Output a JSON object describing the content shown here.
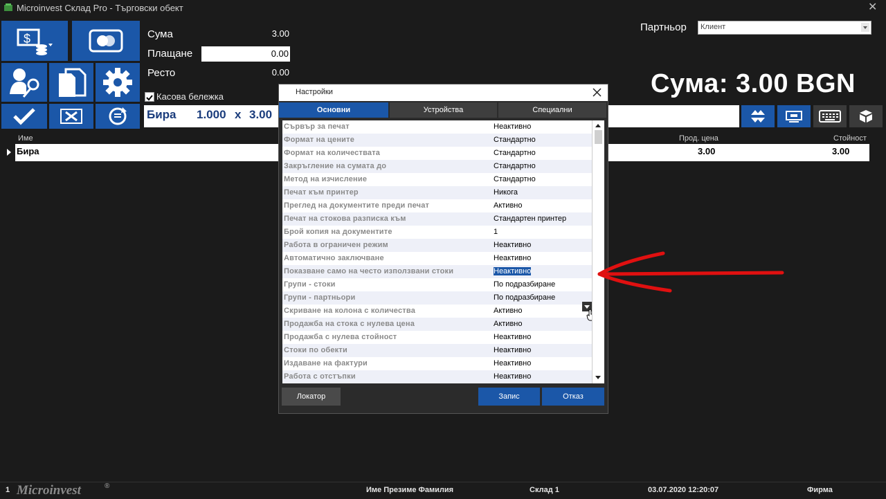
{
  "window": {
    "title": "Microinvest Склад Pro - Търговски обект",
    "close_glyph": "✕"
  },
  "tiles": [
    {
      "name": "cash-payment-tile",
      "icon": "cash-coins-icon"
    },
    {
      "name": "card-payment-tile",
      "icon": "card-icon"
    },
    {
      "name": "user-key-tile",
      "icon": "user-key-icon"
    },
    {
      "name": "documents-tile",
      "icon": "documents-icon"
    },
    {
      "name": "settings-tile",
      "icon": "gear-icon"
    },
    {
      "name": "confirm-tile",
      "icon": "checkmark-icon"
    },
    {
      "name": "cancel-tile",
      "icon": "delete-x-icon"
    },
    {
      "name": "refresh-tile",
      "icon": "refresh-icon"
    }
  ],
  "totals": {
    "sum_label": "Сума",
    "sum_value": "3.00",
    "payment_label": "Плащане",
    "payment_value": "0.00",
    "change_label": "Ресто",
    "change_value": "0.00"
  },
  "receipt_checkbox": {
    "label": "Касова бележка",
    "checked": true
  },
  "partner": {
    "label": "Партньор",
    "value": "Клиент"
  },
  "big_total": "Сума:  3.00 BGN",
  "item_line": {
    "name": "Бира",
    "qty": "1.000",
    "times": "x",
    "price": "3.00"
  },
  "toolbar_icons": [
    "expand-rows-icon",
    "screen-icon",
    "keyboard-icon",
    "cube-icon"
  ],
  "grid": {
    "headers": {
      "name": "Име",
      "sale_price": "Прод. цена",
      "value": "Стойност"
    },
    "rows": [
      {
        "name": "Бира",
        "sale_price": "3.00",
        "value": "3.00"
      }
    ]
  },
  "dialog": {
    "title": "Настройки",
    "tabs": [
      "Основни",
      "Устройства",
      "Специални"
    ],
    "active_tab": 0,
    "settings": [
      {
        "key": "Сървър за печат",
        "value": "Неактивно"
      },
      {
        "key": "Формат на цените",
        "value": "Стандартно"
      },
      {
        "key": "Формат на количествата",
        "value": "Стандартно"
      },
      {
        "key": "Закръгление на сумата до",
        "value": "Стандартно"
      },
      {
        "key": "Метод на изчисление",
        "value": "Стандартно"
      },
      {
        "key": "Печат към принтер",
        "value": "Никога"
      },
      {
        "key": "Преглед на документите преди печат",
        "value": "Активно"
      },
      {
        "key": "Печат на стокова разписка към",
        "value": "Стандартен принтер"
      },
      {
        "key": "Брой копия на документите",
        "value": "1"
      },
      {
        "key": "Работа в ограничен режим",
        "value": "Неактивно"
      },
      {
        "key": "Автоматично заключване",
        "value": "Неактивно"
      },
      {
        "key": "Показване само на често използвани стоки",
        "value": "Неактивно",
        "selected": true
      },
      {
        "key": "Групи - стоки",
        "value": "По подразбиране"
      },
      {
        "key": "Групи - партньори",
        "value": "По подразбиране"
      },
      {
        "key": "Скриване на колона с количества",
        "value": "Активно"
      },
      {
        "key": "Продажба на стока с нулева цена",
        "value": "Активно"
      },
      {
        "key": "Продажба с нулева стойност",
        "value": "Неактивно"
      },
      {
        "key": "Стоки по обекти",
        "value": "Неактивно"
      },
      {
        "key": "Издаване на фактури",
        "value": "Неактивно"
      },
      {
        "key": "Работа с отстъпки",
        "value": "Неактивно"
      }
    ],
    "buttons": {
      "locator": "Локатор",
      "save": "Запис",
      "cancel": "Отказ"
    }
  },
  "statusbar": {
    "page": "1",
    "logo": "Microinvest",
    "logo_mark": "®",
    "user": "Име Презиме Фамилия",
    "warehouse": "Склад 1",
    "datetime": "03.07.2020 12:20:07",
    "company": "Фирма"
  },
  "colors": {
    "accent": "#1b57a8",
    "background": "#1b1b1b",
    "annotation_arrow": "#e01010",
    "selected_value": "#1b57a8"
  }
}
